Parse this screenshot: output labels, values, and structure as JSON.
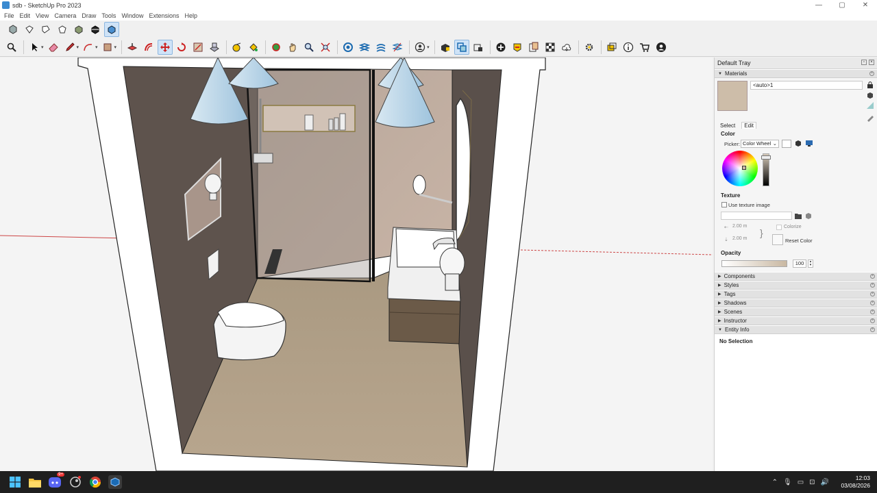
{
  "window": {
    "title": "sdb - SketchUp Pro 2023",
    "controls": [
      "—",
      "▢",
      "✕"
    ]
  },
  "menu": [
    "File",
    "Edit",
    "View",
    "Camera",
    "Draw",
    "Tools",
    "Window",
    "Extensions",
    "Help"
  ],
  "toolbar_top": [
    "iso-view-icon",
    "top-view-icon",
    "front-view-icon",
    "right-view-icon",
    "back-view-icon",
    "left-view-icon",
    "shaded-textures-icon"
  ],
  "toolbar_main": [
    "search-icon",
    "select-icon",
    "eraser-icon",
    "pencil-icon",
    "arc-icon",
    "rectangle-icon",
    "push-pull-icon",
    "offset-icon",
    "move-icon",
    "rotate-icon",
    "scale-icon",
    "follow-me-icon",
    "tape-measure-icon",
    "paint-bucket-icon",
    "orbit-icon",
    "pan-icon",
    "zoom-icon",
    "zoom-extents-icon",
    "warehouse-icon",
    "layers-icon",
    "styles-icon",
    "section-icon",
    "account-icon",
    "extension-warehouse-icon",
    "components-icon",
    "scenes-icon",
    "add-icon",
    "location-icon",
    "layout-icon",
    "checker-icon",
    "cloud-icon",
    "settings-icon",
    "fullscreen-icon",
    "info-icon",
    "cart-icon",
    "user-icon"
  ],
  "tray": {
    "title": "Default Tray",
    "materials": {
      "header": "Materials",
      "material_name": "<auto>1",
      "swatch_color": "#cdbda9",
      "tabs": [
        "Select",
        "Edit"
      ],
      "active_tab": "Edit",
      "color_label": "Color",
      "picker_label": "Picker:",
      "picker_value": "Color Wheel",
      "texture_label": "Texture",
      "use_texture": "Use texture image",
      "width": "2.00 m",
      "height": "2.00 m",
      "colorize": "Colorize",
      "reset_color": "Reset Color",
      "opacity_label": "Opacity",
      "opacity_value": "100"
    },
    "panels": [
      "Components",
      "Styles",
      "Tags",
      "Shadows",
      "Scenes",
      "Instructor"
    ],
    "entity_info": {
      "header": "Entity Info",
      "value": "No Selection"
    }
  },
  "taskbar": {
    "time": "12:03",
    "date": "03/08/2026",
    "discord_badge": "9+"
  }
}
